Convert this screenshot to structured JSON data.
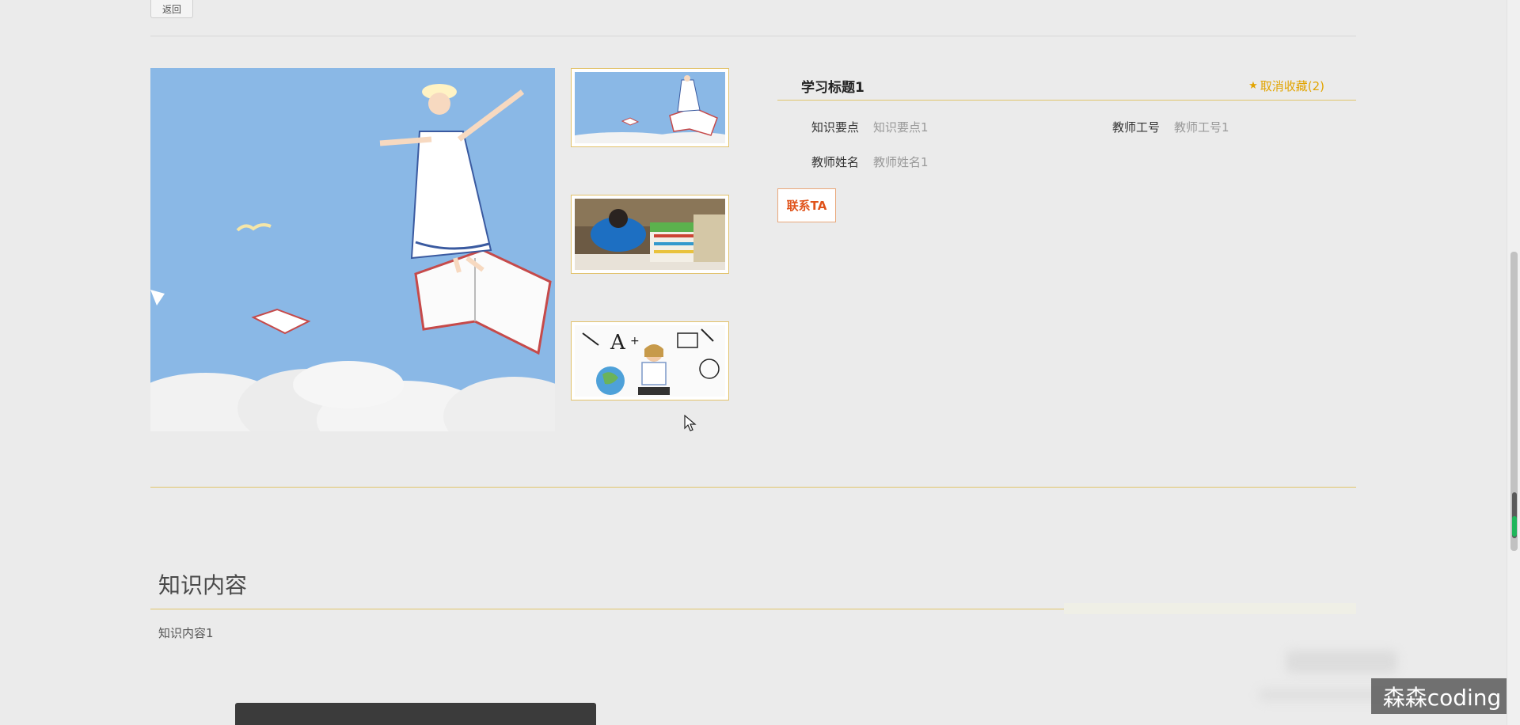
{
  "nav": {
    "back_label": "返回"
  },
  "item": {
    "title": "学习标题1",
    "favorite_label": "取消收藏(2)",
    "fields": {
      "knowledge_points": {
        "label": "知识要点",
        "value": "知识要点1"
      },
      "teacher_id": {
        "label": "教师工号",
        "value": "教师工号1"
      },
      "teacher_name": {
        "label": "教师姓名",
        "value": "教师姓名1"
      }
    },
    "contact_label": "联系TA"
  },
  "gallery": {
    "thumbnails": [
      "girl-on-book-sky",
      "student-studying-books",
      "girl-reading-doodles"
    ]
  },
  "content": {
    "heading": "知识内容",
    "text": "知识内容1"
  },
  "watermark": "森森coding",
  "colors": {
    "accent_gold": "#e0c56b",
    "favorite": "#e2a400",
    "contact": "#e0531b",
    "sky": "#8ab8e6"
  },
  "icons": {
    "favorite": "star-icon",
    "cursor": "mouse-pointer-icon"
  }
}
